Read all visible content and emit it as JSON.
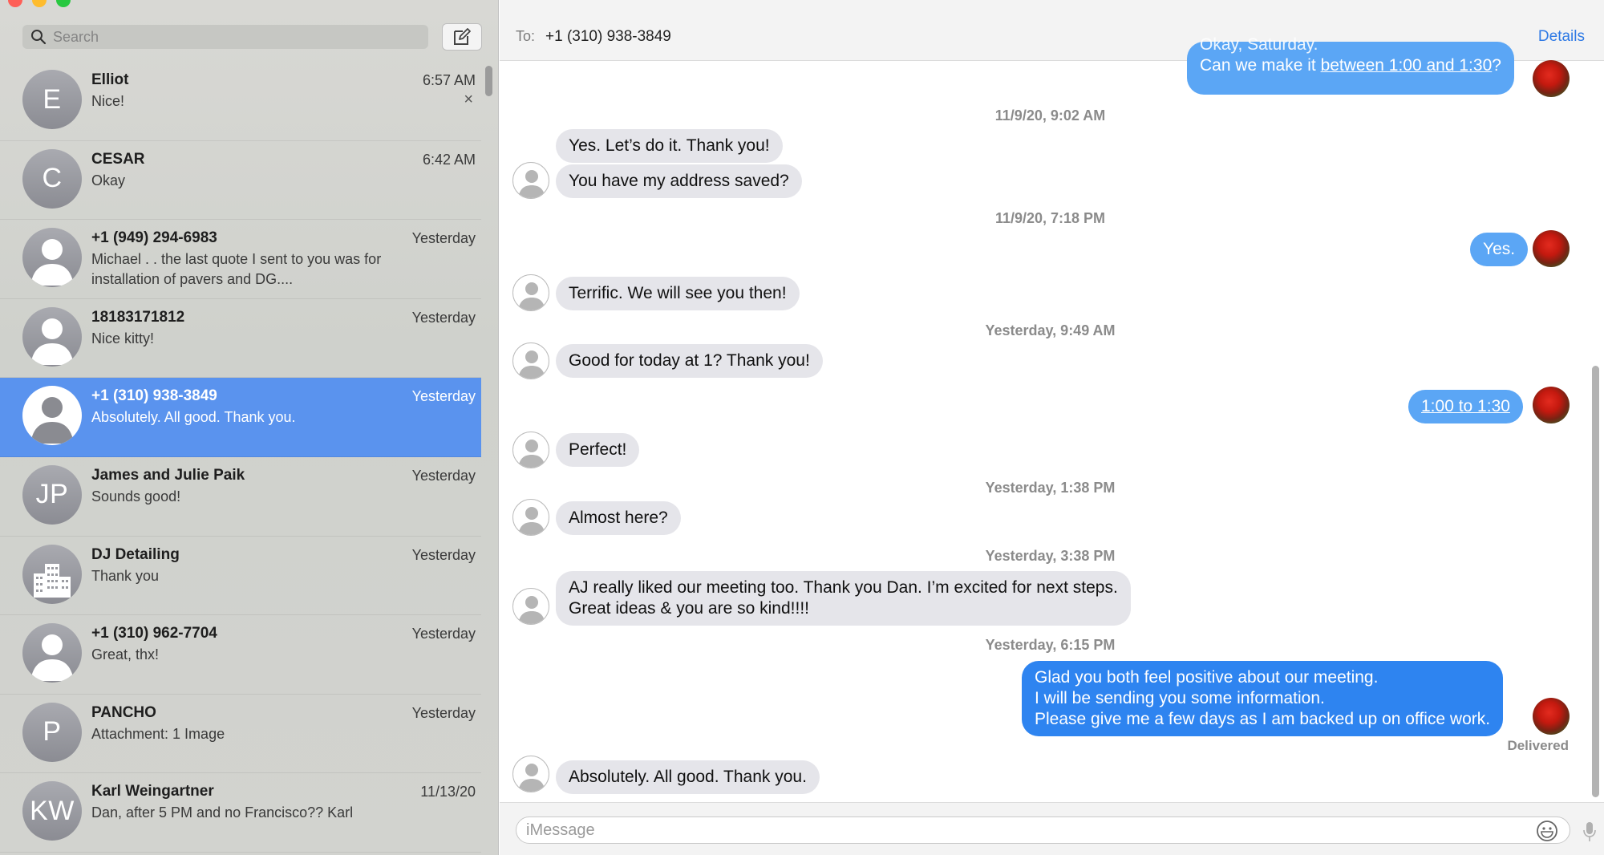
{
  "search": {
    "placeholder": "Search"
  },
  "conversations": [
    {
      "name": "Elliot",
      "time": "6:57 AM",
      "preview": "Nice!",
      "initials": "E",
      "avatar": "initials",
      "selected": false
    },
    {
      "name": "CESAR",
      "time": "6:42 AM",
      "preview": "Okay",
      "initials": "C",
      "avatar": "initials",
      "selected": false
    },
    {
      "name": "+1 (949) 294-6983",
      "time": "Yesterday",
      "preview": "Michael . . the last quote I sent to you was for installation of pavers and DG....",
      "initials": "",
      "avatar": "person-silhouette-icon",
      "selected": false
    },
    {
      "name": "18183171812",
      "time": "Yesterday",
      "preview": "Nice kitty!",
      "initials": "",
      "avatar": "person-silhouette-icon",
      "selected": false
    },
    {
      "name": "+1 (310) 938-3849",
      "time": "Yesterday",
      "preview": "Absolutely. All good. Thank you.",
      "initials": "",
      "avatar": "person-silhouette-icon",
      "selected": true
    },
    {
      "name": "James and Julie Paik",
      "time": "Yesterday",
      "preview": "Sounds good!",
      "initials": "JP",
      "avatar": "initials",
      "selected": false
    },
    {
      "name": "DJ Detailing",
      "time": "Yesterday",
      "preview": "Thank you",
      "initials": "",
      "avatar": "building-icon",
      "selected": false
    },
    {
      "name": "+1 (310) 962-7704",
      "time": "Yesterday",
      "preview": "Great, thx!",
      "initials": "",
      "avatar": "person-silhouette-icon",
      "selected": false
    },
    {
      "name": "PANCHO",
      "time": "Yesterday",
      "preview": "Attachment: 1 Image",
      "initials": "P",
      "avatar": "initials",
      "selected": false
    },
    {
      "name": "Karl Weingartner",
      "time": "11/13/20",
      "preview": "Dan, after 5 PM and no Francisco?? Karl",
      "initials": "KW",
      "avatar": "initials",
      "selected": false
    }
  ],
  "header": {
    "to_label": "To:",
    "to_value": "+1 (310) 938-3849",
    "details": "Details"
  },
  "messages": {
    "m0": {
      "text_pre": "Can we make it ",
      "text_link": "between 1:00 and 1:30",
      "text_post": "?",
      "text_cut": "Okay, Saturday."
    },
    "ts1": "11/9/20, 9:02 AM",
    "m1": "Yes. Let’s do it. Thank you!",
    "m2": "You have my address saved?",
    "ts2": "11/9/20, 7:18 PM",
    "m3": "Yes.",
    "m4": "Terrific. We will see you then!",
    "ts3": "Yesterday, 9:49 AM",
    "m5": "Good for today at 1? Thank you!",
    "m6": "1:00 to 1:30",
    "m7": "Perfect!",
    "ts4": "Yesterday, 1:38 PM",
    "m8": "Almost here?",
    "ts5": "Yesterday, 3:38 PM",
    "m9_l1": "AJ really liked our meeting too. Thank you Dan. I’m excited for next steps.",
    "m9_l2": "Great ideas & you are so kind!!!!",
    "ts6": "Yesterday, 6:15 PM",
    "m10_l1": "Glad you both feel positive about our meeting.",
    "m10_l2": "I will be sending you some information.",
    "m10_l3": "Please give me a few days as I am backed up on office work.",
    "delivered": "Delivered",
    "m11": "Absolutely. All good. Thank you."
  },
  "composer": {
    "placeholder": "iMessage"
  },
  "colors": {
    "accent": "#2f7ae5",
    "outgoing_bubble": "#2e84f0",
    "incoming_bubble": "#e5e5ea",
    "selected_row": "#5a93ee"
  }
}
